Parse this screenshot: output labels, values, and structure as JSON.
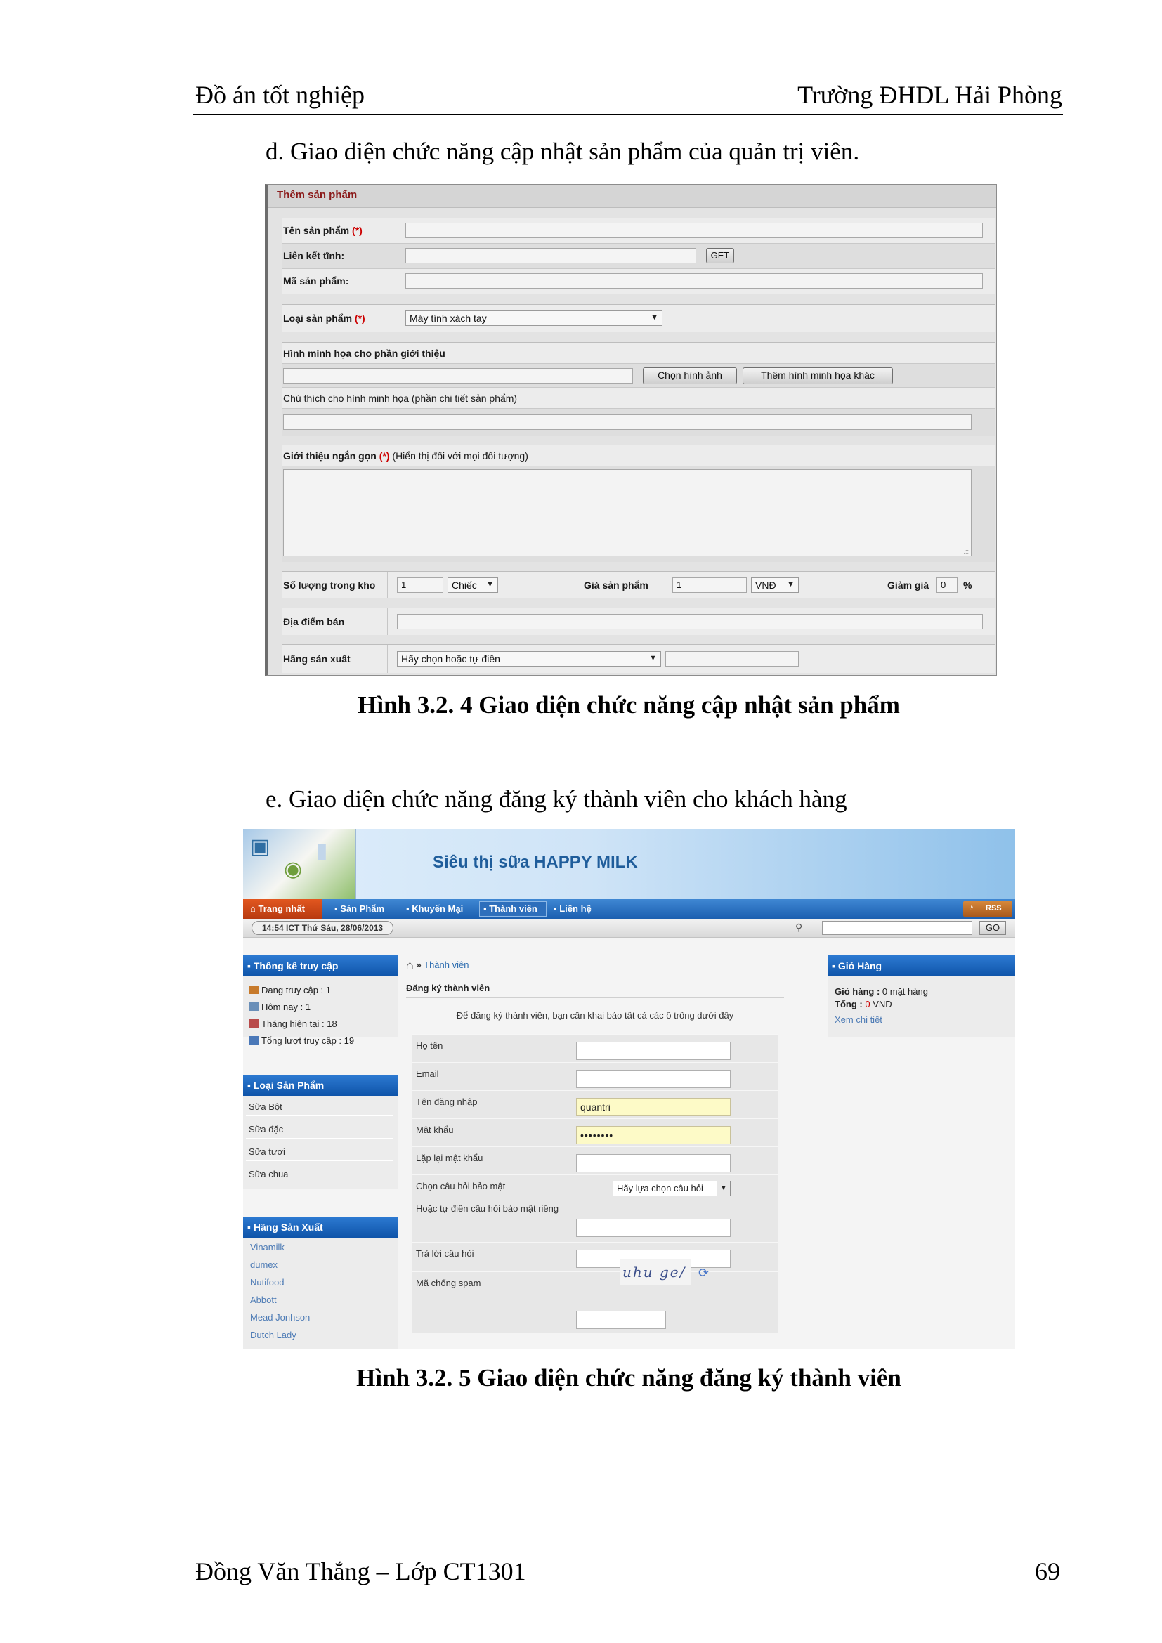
{
  "page": {
    "header_left": "Đồ án tốt nghiệp",
    "header_right": "Trường ĐHDL Hải Phòng",
    "footer_left": "Đồng Văn Thắng – Lớp CT1301",
    "footer_page": "69"
  },
  "section_d": {
    "title": "d.   Giao diện chức năng cập nhật sản phẩm của quản trị viên.",
    "caption": "Hình 3.2. 4 Giao diện chức năng cập nhật sản phẩm"
  },
  "section_e": {
    "title": "e.   Giao diện chức năng đăng ký thành viên cho khách hàng",
    "caption": "Hình 3.2. 5 Giao diện chức năng đăng ký thành viên"
  },
  "add_product": {
    "header": "Thêm sản phẩm",
    "required_mark": "(*)",
    "name_label": "Tên sản phẩm",
    "static_link_label": "Liên kết tĩnh:",
    "get_button": "GET",
    "code_label": "Mã sản phẩm:",
    "type_label": "Loại sản phẩm",
    "type_value": "Máy tính xách tay",
    "image_label": "Hình minh họa cho phần giới thiệu",
    "choose_image_button": "Chọn hình ảnh",
    "add_image_button": "Thêm hình minh họa khác",
    "caption_label": "Chú thích cho hình minh họa (phần chi tiết sản phẩm)",
    "intro_label": "Giới thiệu ngắn gọn",
    "intro_note": "(Hiển thị đối với mọi đối tượng)",
    "stock_label": "Số lượng trong kho",
    "stock_value": "1",
    "unit_value": "Chiếc",
    "price_label": "Giá sản phẩm",
    "price_value": "1",
    "currency_value": "VNĐ",
    "discount_label": "Giảm giá",
    "discount_value": "0",
    "discount_unit": "%",
    "location_label": "Địa điểm bán",
    "maker_label": "Hãng sản xuất",
    "maker_value": "Hãy chọn hoặc tự điền"
  },
  "shop": {
    "site_title": "Siêu thị sữa HAPPY MILK",
    "nav": [
      "Trang nhất",
      "Sản Phẩm",
      "Khuyến Mại",
      "Thành viên",
      "Liên hệ"
    ],
    "rss": "RSS",
    "datetime": "14:54 ICT   Thứ Sáu, 28/06/2013",
    "go_button": "GO",
    "stats_title": "Thống kê truy cập",
    "stats": [
      "Đang truy cập : 1",
      "Hôm nay : 1",
      "Tháng hiện tại : 18",
      "Tổng lượt truy cập : 19"
    ],
    "categories_title": "Loại Sản Phẩm",
    "categories": [
      "Sữa Bột",
      "Sữa đặc",
      "Sữa tươi",
      "Sữa chua"
    ],
    "brands_title": "Hãng Sản Xuất",
    "brands": [
      "Vinamilk",
      "dumex",
      "Nutifood",
      "Abbott",
      "Mead Jonhson",
      "Dutch Lady"
    ],
    "breadcrumb_sep": "»",
    "breadcrumb": "Thành viên",
    "main_title": "Đăng ký thành viên",
    "intro": "Để đăng ký thành viên, bạn cần khai báo tất cả các ô trống dưới đây",
    "form": {
      "fullname": "Họ tên",
      "email": "Email",
      "username": "Tên đăng nhập",
      "username_value": "quantri",
      "password": "Mật khẩu",
      "password_value": "••••••••",
      "repassword": "Lặp lại mật khẩu",
      "question": "Chọn câu hỏi bảo mật",
      "question_placeholder": "Hãy lựa chọn câu hỏi",
      "own_question": "Hoặc tự điền câu hỏi bảo mật riêng",
      "answer": "Trả lời câu hỏi",
      "captcha_label": "Mã chống spam",
      "captcha_text": "uhu ge/"
    },
    "cart_title": "Giỏ Hàng",
    "cart_line1_label": "Giỏ hàng :",
    "cart_line1_value": "0 mặt hàng",
    "cart_line2_label": "Tổng :",
    "cart_line2_value": "0",
    "cart_line2_unit": "VND",
    "cart_link": "Xem chi tiết"
  }
}
